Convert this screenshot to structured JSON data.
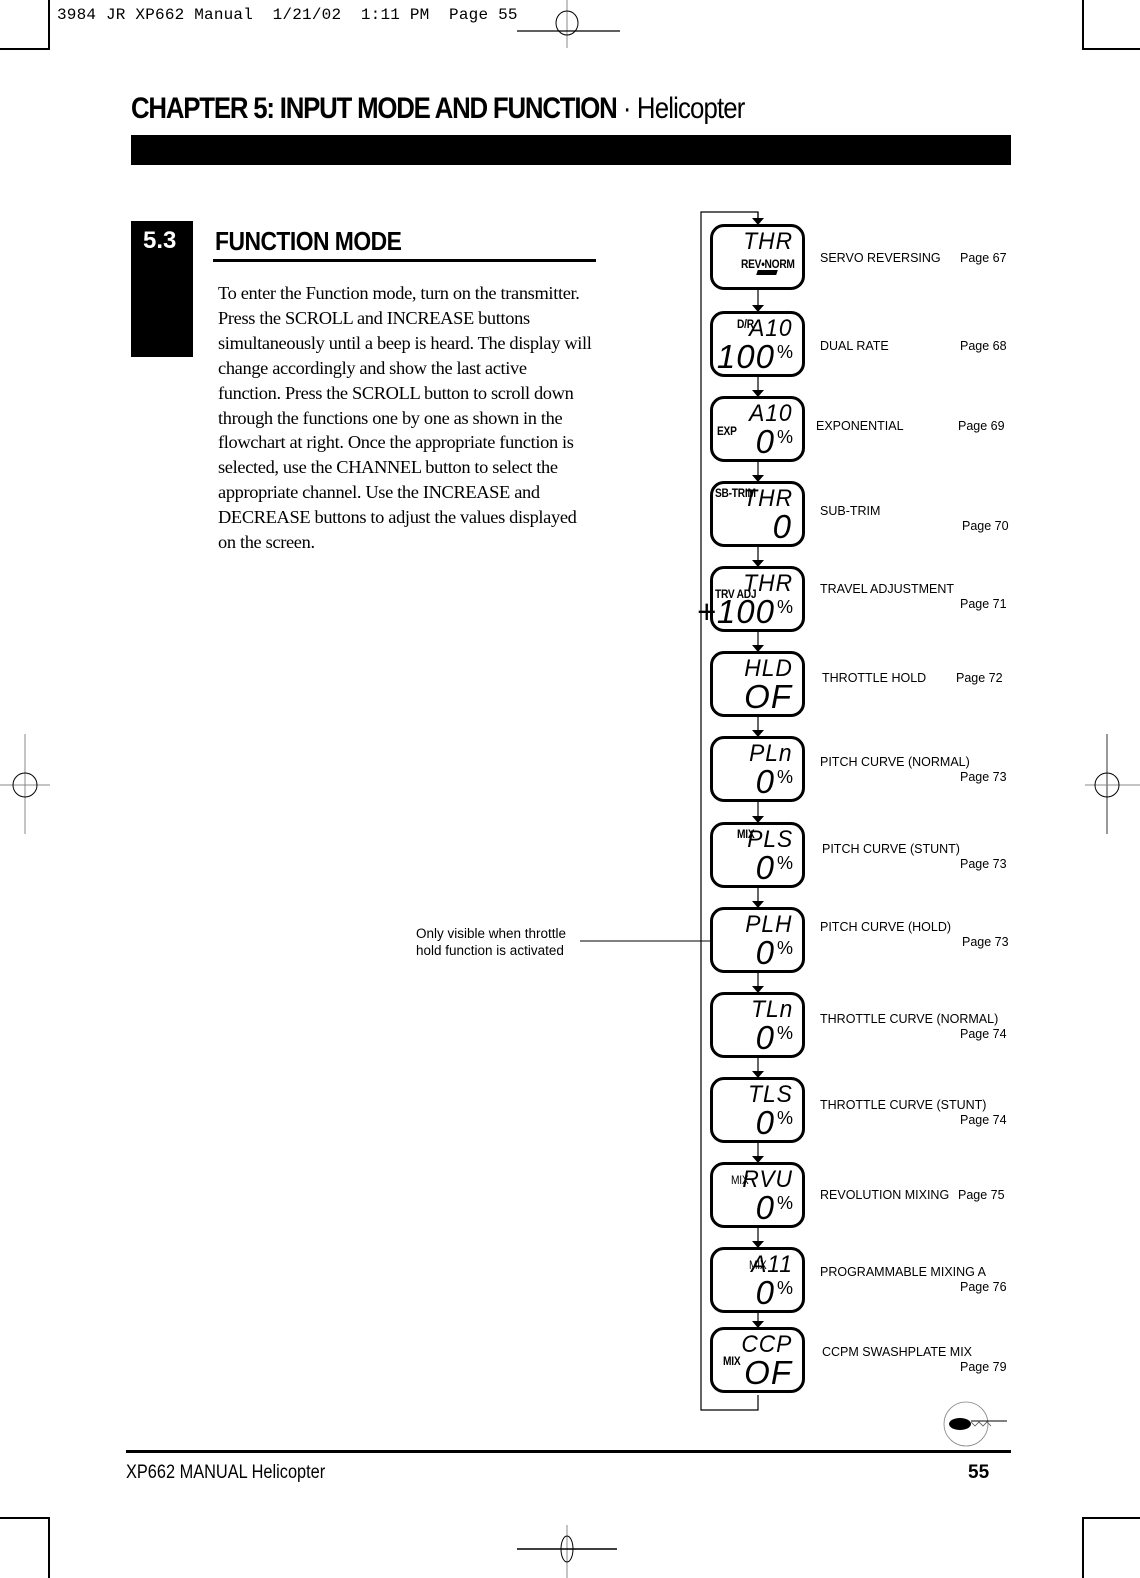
{
  "slug": "3984 JR XP662 Manual  1/21/02  1:11 PM  Page 55",
  "chapter": {
    "title": "CHAPTER 5: INPUT MODE AND FUNCTION",
    "separator": " · ",
    "subtitle": "Helicopter"
  },
  "section": {
    "number": "5.3",
    "title": "FUNCTION MODE",
    "body_lines": [
      "To enter the Function mode, turn on the transmitter.",
      "Press the SCROLL and INCREASE buttons",
      "simultaneously until a beep is heard. The display will",
      "change accordingly and show the last active",
      "function. Press the SCROLL button to scroll down",
      "through the functions one by one as shown in the",
      "flowchart at right. Once the appropriate function is",
      "selected, use the CHANNEL button to select the",
      "appropriate channel. Use the INCREASE and",
      "DECREASE buttons to adjust the values displayed",
      "on the screen."
    ]
  },
  "flowchart": {
    "note": [
      "Only visible when throttle",
      "hold function is activated"
    ],
    "items": [
      {
        "lcd_top": "THR",
        "lcd_label": "REV•NORM",
        "lcd_value": "",
        "pct": "",
        "name": "SERVO REVERSING",
        "page": "Page 67"
      },
      {
        "lcd_top": "A10",
        "lcd_label": "D/R",
        "lcd_value": "100",
        "pct": "%",
        "name": "DUAL RATE",
        "page": "Page 68"
      },
      {
        "lcd_top": "A10",
        "lcd_label": "EXP",
        "lcd_value": "0",
        "pct": "%",
        "name": "EXPONENTIAL",
        "page": "Page 69"
      },
      {
        "lcd_top": "THR",
        "lcd_label": "SB-TRIM",
        "lcd_value": "0",
        "pct": "",
        "name": "SUB-TRIM",
        "page": "Page 70"
      },
      {
        "lcd_top": "THR",
        "lcd_label": "TRV ADJ",
        "lcd_value": "+100",
        "pct": "%",
        "name": "TRAVEL ADJUSTMENT",
        "page": "Page 71"
      },
      {
        "lcd_top": "HLD",
        "lcd_label": "",
        "lcd_value": "OF",
        "pct": "",
        "name": "THROTTLE HOLD",
        "page": "Page 72"
      },
      {
        "lcd_top": "PLn",
        "lcd_label": "",
        "lcd_value": "0",
        "pct": "%",
        "name": "PITCH CURVE (NORMAL)",
        "page": "Page 73"
      },
      {
        "lcd_top": "PLS",
        "lcd_label": "MIX",
        "lcd_value": "0",
        "pct": "%",
        "name": "PITCH CURVE (STUNT)",
        "page": "Page 73"
      },
      {
        "lcd_top": "PLH",
        "lcd_label": "",
        "lcd_value": "0",
        "pct": "%",
        "name": "PITCH CURVE (HOLD)",
        "page": "Page 73"
      },
      {
        "lcd_top": "TLn",
        "lcd_label": "",
        "lcd_value": "0",
        "pct": "%",
        "name": "THROTTLE CURVE (NORMAL)",
        "page": "Page 74"
      },
      {
        "lcd_top": "TLS",
        "lcd_label": "",
        "lcd_value": "0",
        "pct": "%",
        "name": "THROTTLE CURVE (STUNT)",
        "page": "Page 74"
      },
      {
        "lcd_top": "RVU",
        "lcd_label": "MIX",
        "lcd_value": "0",
        "pct": "%",
        "name": "REVOLUTION MIXING",
        "page": "Page 75"
      },
      {
        "lcd_top": "A11",
        "lcd_label": "MIX",
        "lcd_value": "0",
        "pct": "%",
        "name": "PROGRAMMABLE MIXING A",
        "page": "Page 76"
      },
      {
        "lcd_top": "CCP",
        "lcd_label": "MIX",
        "lcd_value": "OF",
        "pct": "",
        "name": "CCPM SWASHPLATE MIX",
        "page": "Page 79"
      }
    ]
  },
  "footer": {
    "left": "XP662 MANUAL  Helicopter",
    "page_number": "55"
  }
}
